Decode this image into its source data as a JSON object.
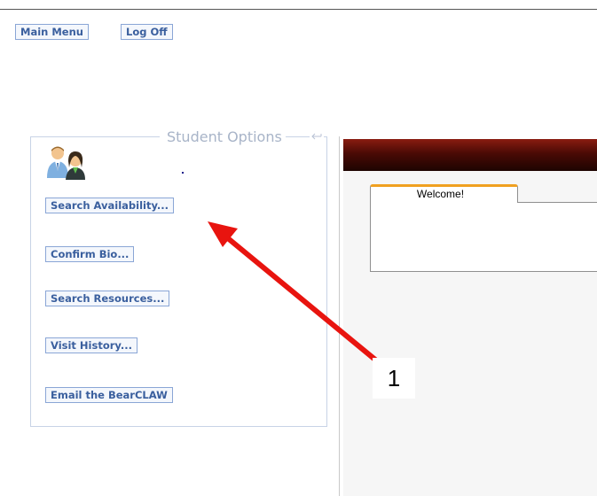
{
  "header": {
    "main_menu_label": "Main Menu",
    "log_off_label": "Log Off"
  },
  "student_options": {
    "legend": "Student Options",
    "buttons": [
      {
        "label": "Search Availability..."
      },
      {
        "label": "Confirm Bio..."
      },
      {
        "label": "Search Resources..."
      },
      {
        "label": "Visit History..."
      },
      {
        "label": "Email the BearCLAW"
      }
    ]
  },
  "content": {
    "tab_label": "Welcome!"
  },
  "annotation": {
    "callout_number": "1",
    "arrow_color": "#e8140f"
  },
  "colors": {
    "button_border": "#8aa6d6",
    "button_text": "#3a5f9e",
    "tab_accent": "#f0a020",
    "header_bar": "#4a0a05"
  }
}
